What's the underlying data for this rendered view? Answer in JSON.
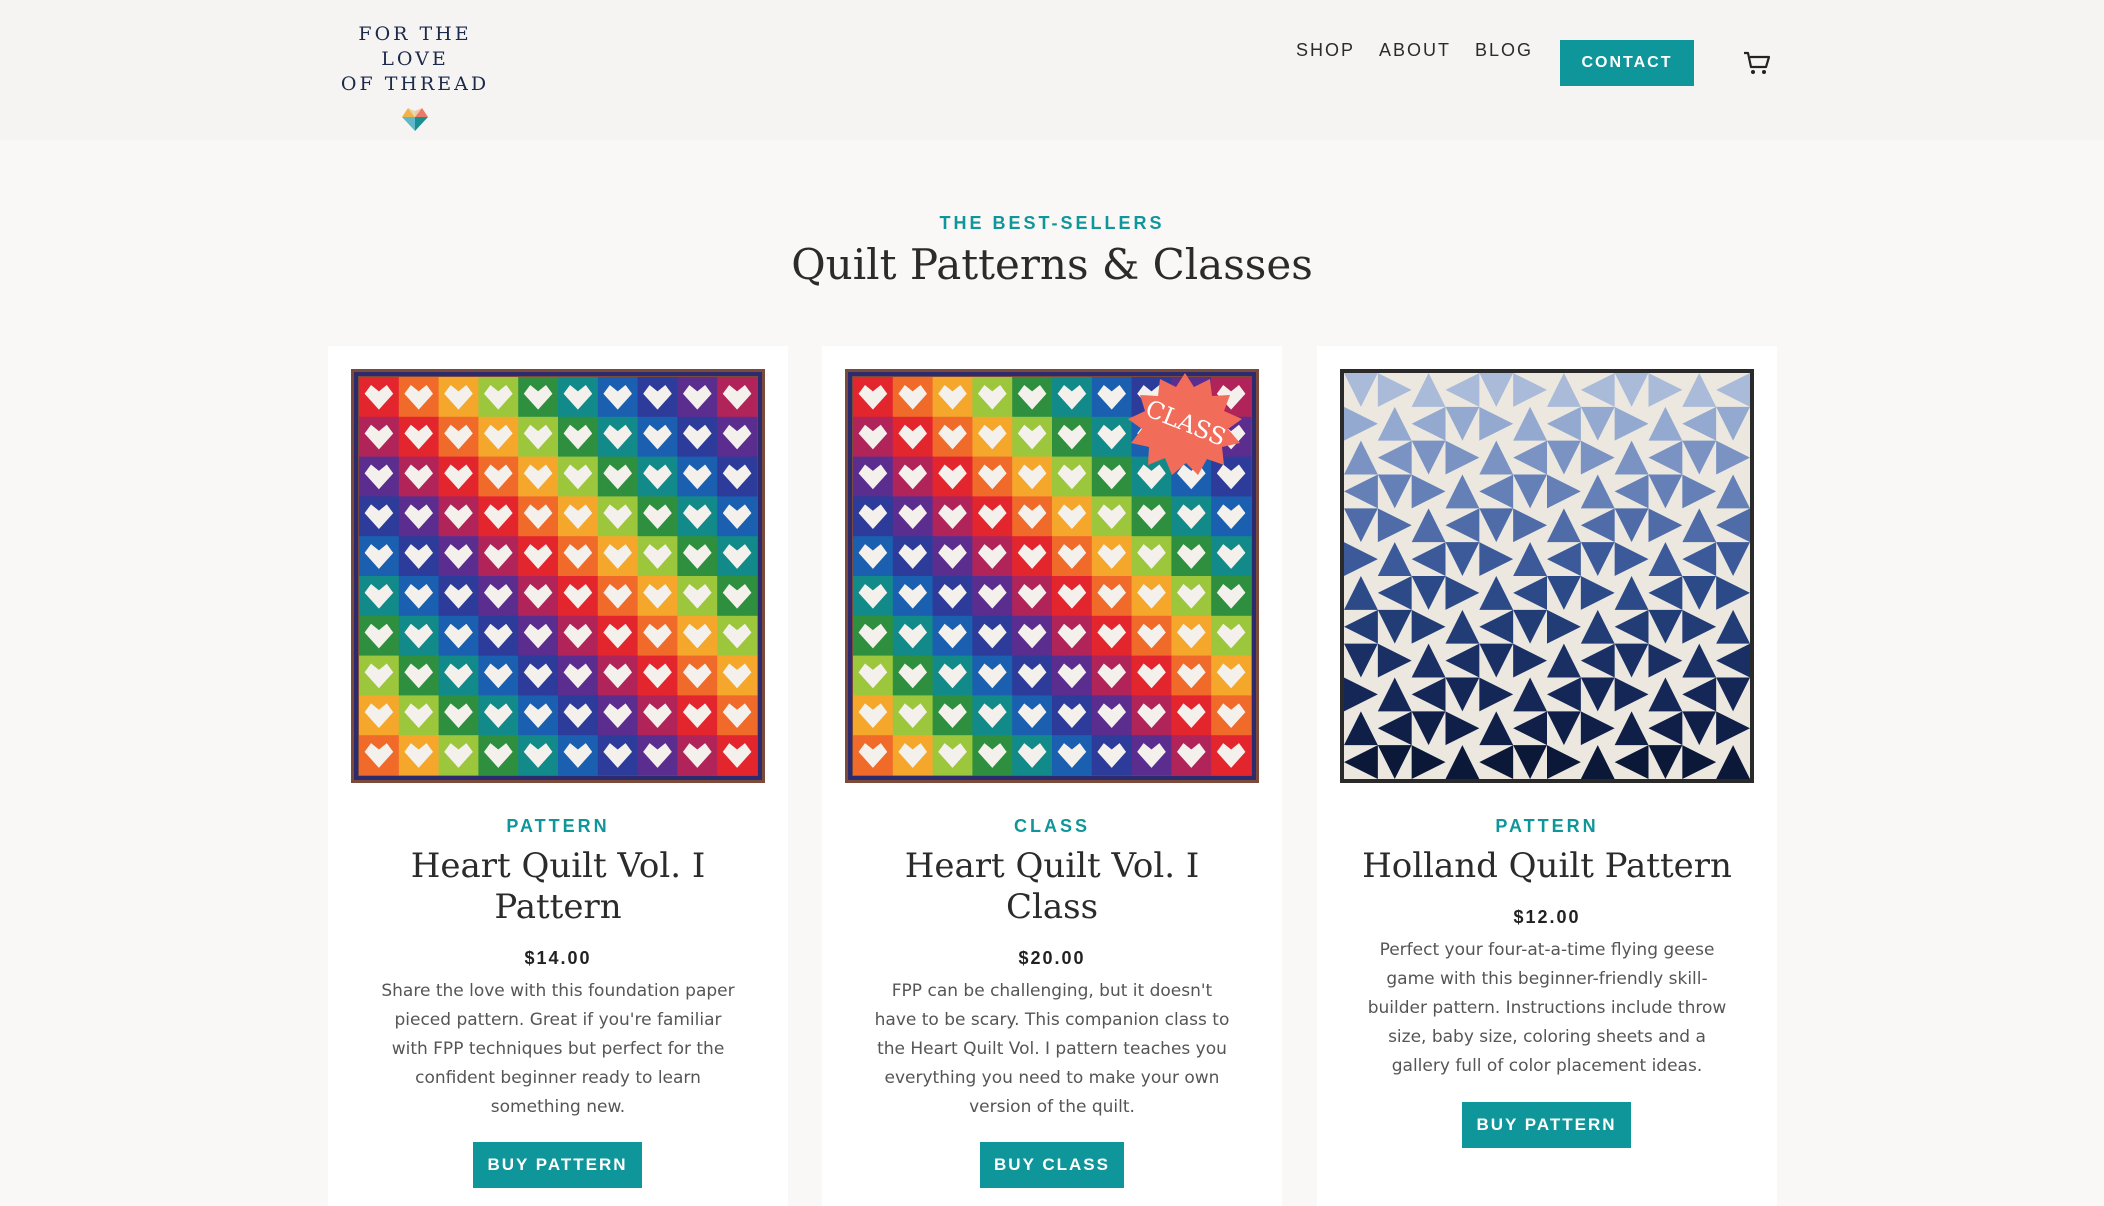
{
  "brand": {
    "line1": "FOR THE LOVE",
    "line2": "OF THREAD",
    "logo_colors": [
      "#f2b24b",
      "#1b8f8f",
      "#e97b6a",
      "#5fb8c8"
    ]
  },
  "nav": {
    "items": [
      "SHOP",
      "ABOUT",
      "BLOG"
    ],
    "contact_label": "CONTACT",
    "cart_icon": "cart-icon"
  },
  "section": {
    "eyebrow": "THE BEST-SELLERS",
    "title": "Quilt Patterns & Classes"
  },
  "colors": {
    "accent": "#0f969a",
    "badge": "#f26c5a"
  },
  "products": [
    {
      "type": "PATTERN",
      "title_line1": "Heart Quilt Vol. I",
      "title_line2": "Pattern",
      "price": "$14.00",
      "description": "Share the love with this foundation paper pieced pattern. Great if you're familiar with FPP techniques but perfect for the confident beginner ready to learn something new.",
      "button": "BUY PATTERN",
      "image": "rainbow-heart-quilt"
    },
    {
      "type": "CLASS",
      "title_line1": "Heart Quilt Vol. I",
      "title_line2": "Class",
      "price": "$20.00",
      "description": "FPP can be challenging, but it doesn't have to be scary. This companion class to the Heart Quilt Vol. I pattern teaches you everything you need to make your own version of the quilt.",
      "button": "BUY CLASS",
      "badge": "CLASS",
      "image": "rainbow-heart-quilt"
    },
    {
      "type": "PATTERN",
      "title_line1": "Holland Quilt Pattern",
      "price": "$12.00",
      "description": "Perfect your four-at-a-time flying geese game with this beginner-friendly skill-builder pattern. Instructions include throw size, baby size, coloring sheets and a gallery full of color placement ideas.",
      "button": "BUY PATTERN",
      "image": "blue-flying-geese-quilt"
    }
  ]
}
